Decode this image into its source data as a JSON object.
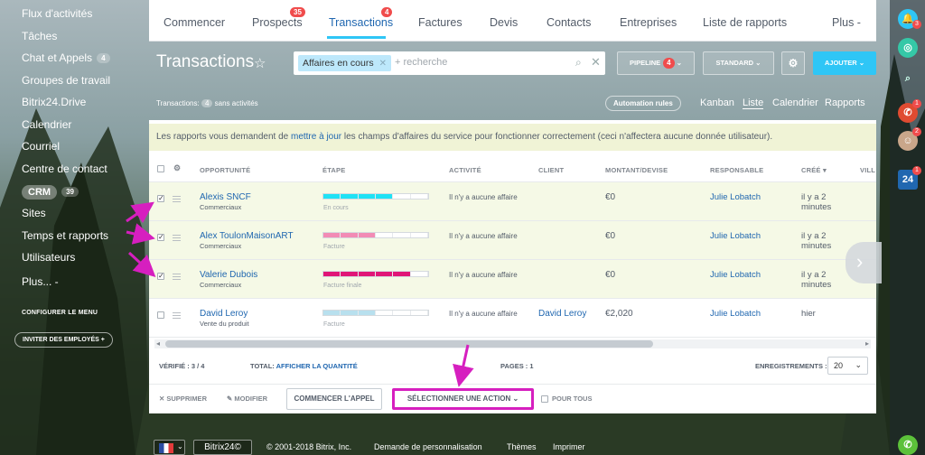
{
  "left_menu": {
    "items": [
      {
        "label": "Flux d'activités"
      },
      {
        "label": "Tâches"
      },
      {
        "label": "Chat et Appels",
        "badge": "4"
      },
      {
        "label": "Groupes de travail"
      },
      {
        "label": "Bitrix24.Drive"
      },
      {
        "label": "Calendrier"
      },
      {
        "label": "Courriel"
      },
      {
        "label": "Centre de contact"
      },
      {
        "label": "CRM",
        "badge": "39"
      },
      {
        "label": "Sites"
      },
      {
        "label": "Temps et rapports"
      },
      {
        "label": "Utilisateurs"
      },
      {
        "label": "Plus... -"
      }
    ],
    "configure": "CONFIGURER LE MENU",
    "invite": "INVITER DES EMPLOYÉS"
  },
  "top_nav": {
    "items": [
      {
        "label": "Commencer"
      },
      {
        "label": "Prospects",
        "count": "35"
      },
      {
        "label": "Transactions",
        "count": "4"
      },
      {
        "label": "Factures"
      },
      {
        "label": "Devis"
      },
      {
        "label": "Contacts"
      },
      {
        "label": "Entreprises"
      },
      {
        "label": "Liste de rapports"
      },
      {
        "label": "Plus -"
      }
    ]
  },
  "toolbar": {
    "title": "Transactions",
    "filter_tag": "Affaires en cours",
    "search_placeholder": "+ recherche",
    "pipeline_label": "PIPELINE",
    "pipeline_count": "4",
    "standard_label": "STANDARD",
    "add_label": "AJOUTER"
  },
  "subbar": {
    "text_before": "Transactions:",
    "count": "4",
    "text_after": "sans activités",
    "automation": "Automation rules",
    "views": [
      "Kanban",
      "Liste",
      "Calendrier",
      "Rapports"
    ]
  },
  "notice": {
    "before": "Les rapports vous demandent de ",
    "link": "mettre à jour",
    "after": " les champs d'affaires du service pour fonctionner correctement (ceci n'affectera aucune donnée utilisateur)."
  },
  "table": {
    "headers": [
      "OPPORTUNITÉ",
      "ÉTAPE",
      "ACTIVITÉ",
      "CLIENT",
      "MONTANT/DEVISE",
      "RESPONSABLE",
      "CRÉÉ",
      "VILL"
    ],
    "rows": [
      {
        "name": "Alexis SNCF",
        "type": "Commerciaux",
        "stage": "En cours",
        "stage_progress": 0.67,
        "stage_color": "#1fe2f5",
        "activity": "Il n'y a aucune affaire",
        "client": "",
        "amount": "€0",
        "responsible": "Julie Lobatch",
        "created": "il y a 2 minutes",
        "checked": true
      },
      {
        "name": "Alex ToulonMaisonART",
        "type": "Commerciaux",
        "stage": "Facture",
        "stage_progress": 0.5,
        "stage_color": "#f28bb5",
        "activity": "Il n'y a aucune affaire",
        "client": "",
        "amount": "€0",
        "responsible": "Julie Lobatch",
        "created": "il y a 2 minutes",
        "checked": true
      },
      {
        "name": "Valerie Dubois",
        "type": "Commerciaux",
        "stage": "Facture finale",
        "stage_progress": 0.83,
        "stage_color": "#e01577",
        "activity": "Il n'y a aucune affaire",
        "client": "",
        "amount": "€0",
        "responsible": "Julie Lobatch",
        "created": "il y a 2 minutes",
        "checked": true
      },
      {
        "name": "David Leroy",
        "type": "Vente du produit",
        "stage": "Facture",
        "stage_progress": 0.5,
        "stage_color": "#b8e0ee",
        "activity": "Il n'y a aucune affaire",
        "client": "David Leroy",
        "amount": "€2,020",
        "responsible": "Julie Lobatch",
        "created": "hier",
        "checked": false
      }
    ]
  },
  "footer": {
    "verified": "VÉRIFIÉ : 3 / 4",
    "total_label": "TOTAL:",
    "total_link": "AFFICHER LA QUANTITÉ",
    "pages": "PAGES : 1",
    "records_label": "ENREGISTREMENTS :",
    "records_value": "20"
  },
  "actions": {
    "delete": "SUPPRIMER",
    "edit": "MODIFIER",
    "call": "COMMENCER L'APPEL",
    "select_action": "SÉLECTIONNER UNE ACTION",
    "for_all": "POUR TOUS"
  },
  "right_rail": {
    "notif_count": "3",
    "phone_count": "1",
    "avatar_count": "2",
    "b24_count": "1",
    "b24_label": "24"
  },
  "bottom": {
    "logo": "Bitrix24©",
    "copyright": "© 2001-2018 Bitrix, Inc.",
    "custom": "Demande de personnalisation",
    "themes": "Thèmes",
    "print": "Imprimer"
  },
  "colors": {
    "accent": "#2fc6f6",
    "link": "#2067b0",
    "badge_red": "#f04c4c",
    "annotation_magenta": "#d61fbf"
  }
}
